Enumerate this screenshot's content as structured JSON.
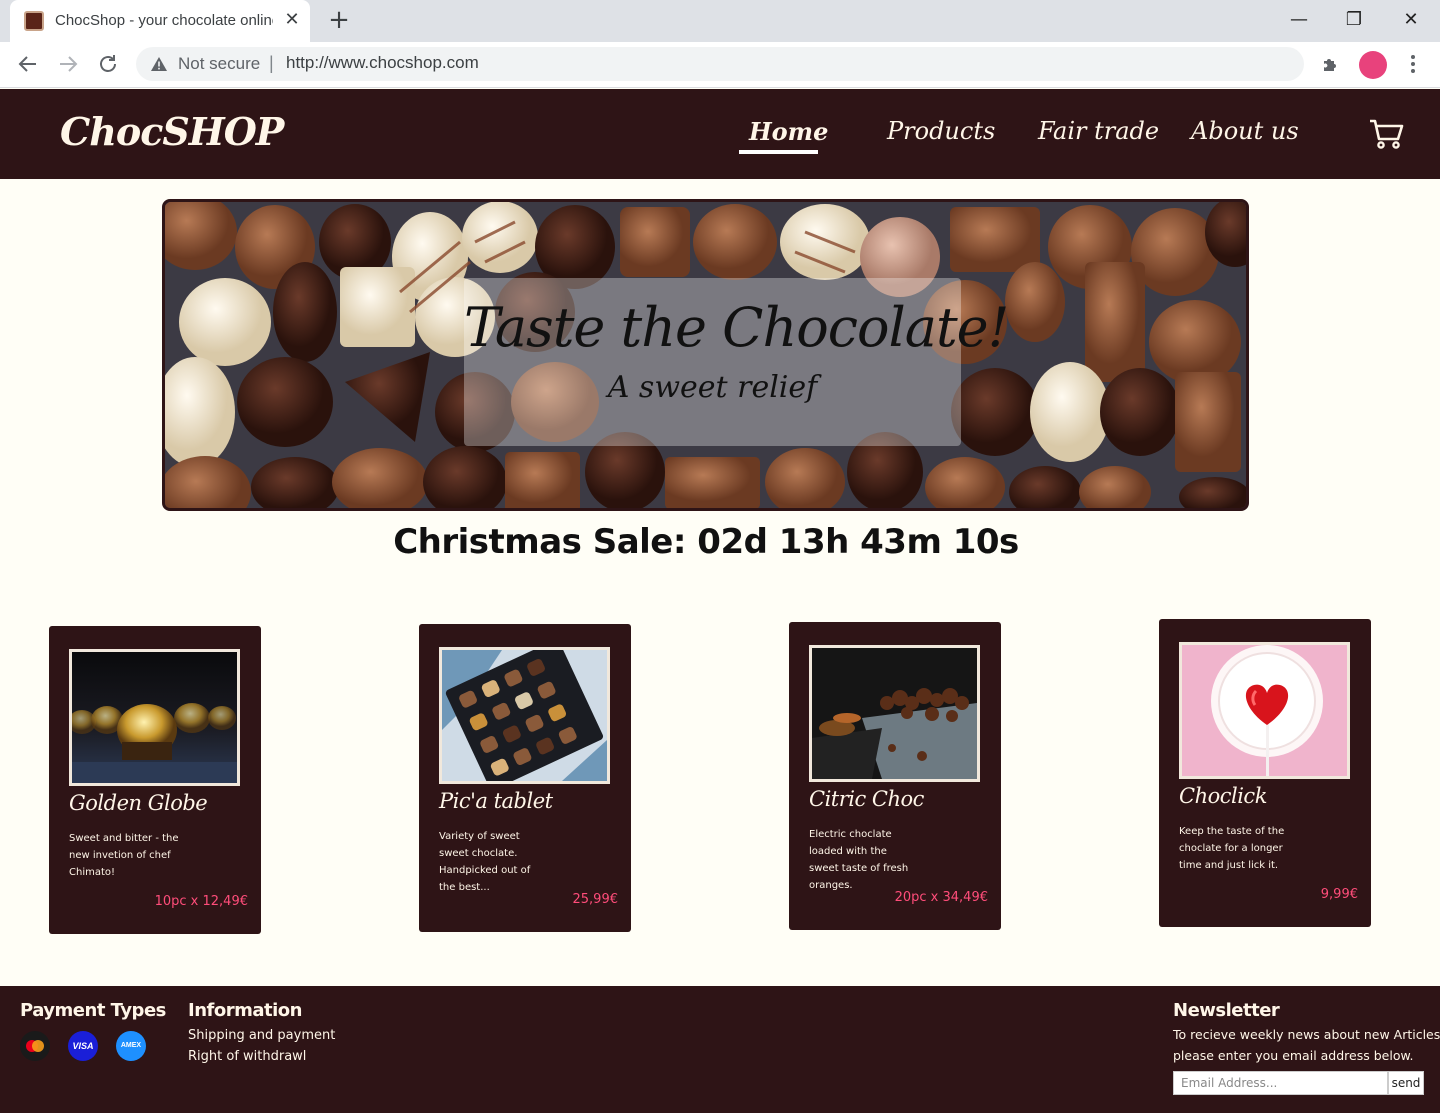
{
  "browser": {
    "tab_title": "ChocShop - your chocolate online shop",
    "tab_close": "✕",
    "new_tab": "+",
    "security_label": "Not secure",
    "separator": "|",
    "url": "http://www.chocshop.com",
    "window_controls": {
      "minimize": "—",
      "maximize": "❐",
      "close": "✕"
    }
  },
  "site": {
    "logo": "ChocSHOP",
    "nav": [
      {
        "label": "Home",
        "active": true
      },
      {
        "label": "Products",
        "active": false
      },
      {
        "label": "Fair trade",
        "active": false
      },
      {
        "label": "About us",
        "active": false
      }
    ]
  },
  "hero": {
    "title": "Taste the Chocolate!",
    "subtitle": "A sweet relief"
  },
  "countdown": "Christmas Sale: 02d 13h 43m 10s",
  "products": [
    {
      "name": "Golden Globe",
      "description": "Sweet and bitter - the new invetion of chef Chimato!",
      "price": "10pc x 12,49€"
    },
    {
      "name": "Pic'a tablet",
      "description": "Variety of sweet sweet choclate. Handpicked out of the best...",
      "price": "25,99€"
    },
    {
      "name": "Citric Choc",
      "description": "Electric choclate loaded with the sweet taste of fresh oranges.",
      "price": "20pc x 34,49€"
    },
    {
      "name": "Choclick",
      "description": "Keep the taste of the choclate for a longer time and just lick it.",
      "price": "9,99€"
    }
  ],
  "footer": {
    "payment": {
      "heading": "Payment Types",
      "icons": [
        "mastercard-icon",
        "visa-icon",
        "amex-icon"
      ],
      "visa_text": "VISA",
      "amex_text": "AMEX"
    },
    "information": {
      "heading": "Information",
      "links": [
        "Shipping and payment",
        "Right of withdrawl"
      ]
    },
    "newsletter": {
      "heading": "Newsletter",
      "text_line1": "To recieve weekly news about new Articles,",
      "text_line2": "please enter you email address below.",
      "placeholder": "Email Address...",
      "button": "send"
    }
  },
  "colors": {
    "header_bg": "#2e1416",
    "page_bg": "#fffef6",
    "price": "#ff4d7a",
    "profile": "#e8427c"
  }
}
